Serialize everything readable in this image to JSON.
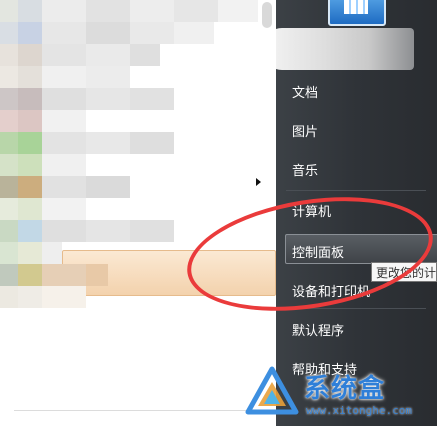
{
  "start_menu": {
    "right_items": [
      {
        "label": "文档",
        "name": "documents"
      },
      {
        "label": "图片",
        "name": "pictures"
      },
      {
        "label": "音乐",
        "name": "music"
      },
      {
        "label": "计算机",
        "name": "computer"
      },
      {
        "label": "控制面板",
        "name": "control-panel",
        "selected": true
      },
      {
        "label": "设备和打印机",
        "name": "devices-printers"
      },
      {
        "label": "默认程序",
        "name": "default-programs"
      },
      {
        "label": "帮助和支持",
        "name": "help-support"
      }
    ],
    "tooltip": "更改您的计"
  },
  "watermark": {
    "text": "系统盒",
    "url": "www.xitonghe.com",
    "logo_icon": "xitonghe-logo-icon"
  },
  "colors": {
    "annotation": "#ea3b3b",
    "right_panel": "#2f3338",
    "watermark_blue": "#2f7fd8"
  }
}
